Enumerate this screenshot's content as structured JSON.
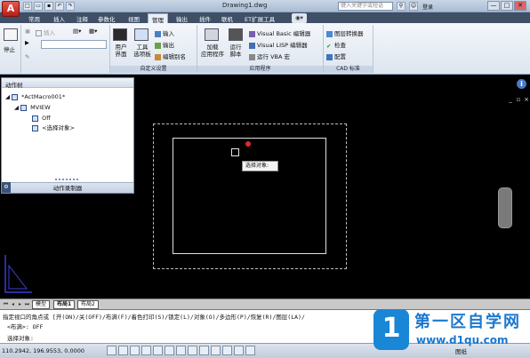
{
  "title_bar": {
    "app_button": "A",
    "document_title": "Drawing1.dwg",
    "search_placeholder": "键入关键字或短语",
    "login": "登录",
    "minimize": "—",
    "maximize": "□",
    "close": "✕"
  },
  "ribbon_tabs": [
    {
      "label": "常用"
    },
    {
      "label": "插入"
    },
    {
      "label": "注释"
    },
    {
      "label": "参数化"
    },
    {
      "label": "视图"
    },
    {
      "label": "管理"
    },
    {
      "label": "输出"
    },
    {
      "label": "插件"
    },
    {
      "label": "联机"
    },
    {
      "label": "ET扩展工具"
    }
  ],
  "ribbon": {
    "stop_label": "停止",
    "insert_label": "插入",
    "user_interface": {
      "line1": "用户",
      "line2": "界面"
    },
    "tool_palettes": {
      "line1": "工具",
      "line2": "选项板"
    },
    "import": "输入",
    "export": "输出",
    "edit_aliases": "编辑别名",
    "customization_title": "自定义设置",
    "load_app": {
      "line1": "加载",
      "line2": "应用程序"
    },
    "run_script": {
      "line1": "运行",
      "line2": "脚本"
    },
    "vb_editor": "Visual Basic 编辑器",
    "lisp_editor": "Visual LISP 编辑器",
    "run_vba": "运行 VBA 宏",
    "applications_title": "应用程序",
    "layer_translator": "图层转换器",
    "check": "检查",
    "configure": "配置",
    "cad_standards_title": "CAD 标准"
  },
  "action_recorder": {
    "header": "动作树",
    "macro_name": "*ActMacro001*",
    "command": "MVIEW",
    "option_value": "Off",
    "request_select": "<选择对象>",
    "footer": "动作录制器"
  },
  "canvas": {
    "tooltip": "选择对象:",
    "info_icon": "i"
  },
  "layout_tabs": [
    {
      "label": "模型"
    },
    {
      "label": "布局1"
    },
    {
      "label": "布局2"
    }
  ],
  "command_line": {
    "prompt_line": "指定视口的角点或 [开(ON)/关(OFF)/布满(F)/着色打印(S)/锁定(L)/对象(O)/多边形(P)/恢复(R)/图层(LA)/",
    "history_line": "<布满>: OFF",
    "current": "选择对象:"
  },
  "status_bar": {
    "coordinates": "110.2942,  196.9553, 0.0000",
    "space": "图纸"
  },
  "watermark": {
    "logo_char": "1",
    "title": "第一区自学网",
    "url": "www.d1qu.com"
  }
}
